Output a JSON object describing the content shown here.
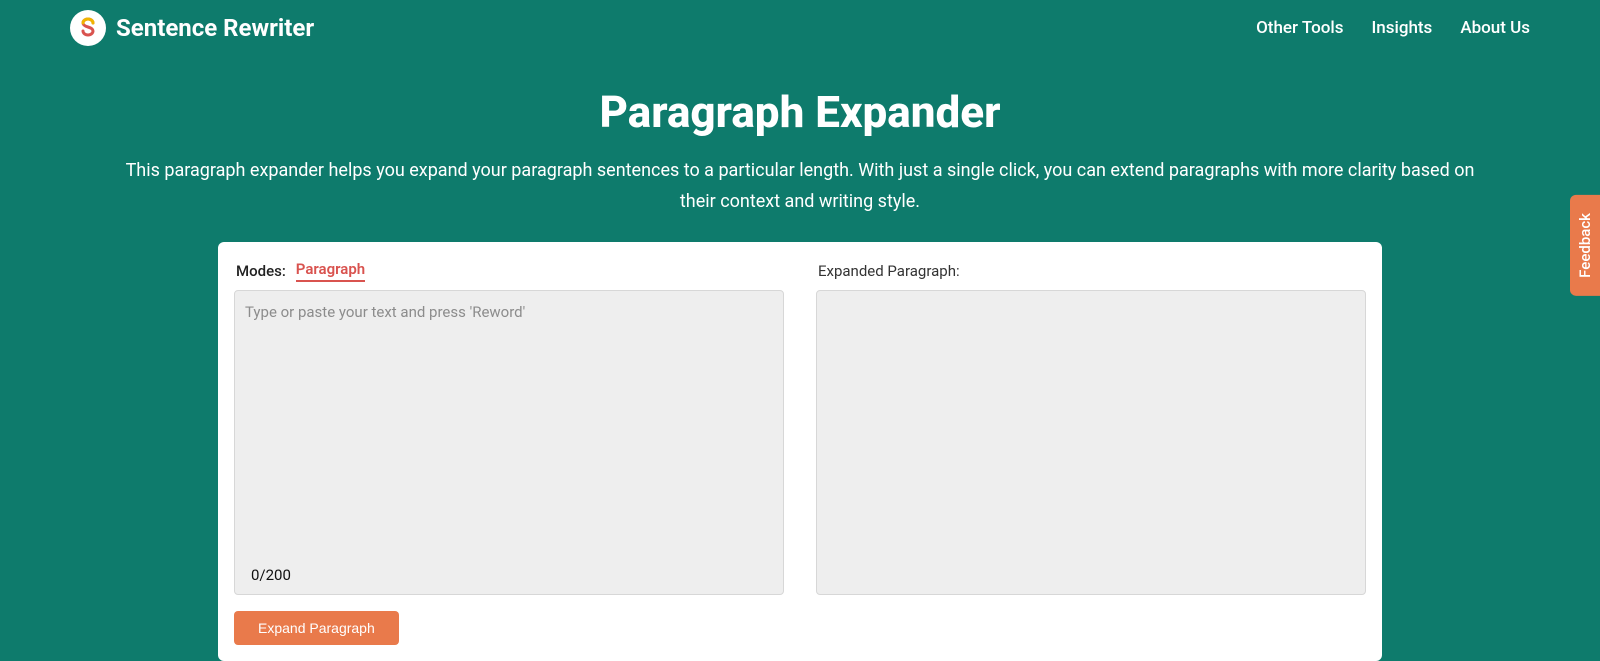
{
  "brand": {
    "name": "Sentence Rewriter"
  },
  "nav": {
    "other_tools": "Other Tools",
    "insights": "Insights",
    "about": "About Us"
  },
  "hero": {
    "title": "Paragraph Expander",
    "subtitle": "This paragraph expander helps you expand your paragraph sentences to a particular length. With just a single click, you can extend paragraphs with more clarity based on their context and writing style."
  },
  "tool": {
    "modes_label": "Modes:",
    "mode_paragraph": "Paragraph",
    "input_placeholder": "Type or paste your text and press 'Reword'",
    "counter": "0/200",
    "expand_btn": "Expand Paragraph",
    "output_label": "Expanded Paragraph:"
  },
  "feedback": {
    "label": "Feedback"
  }
}
